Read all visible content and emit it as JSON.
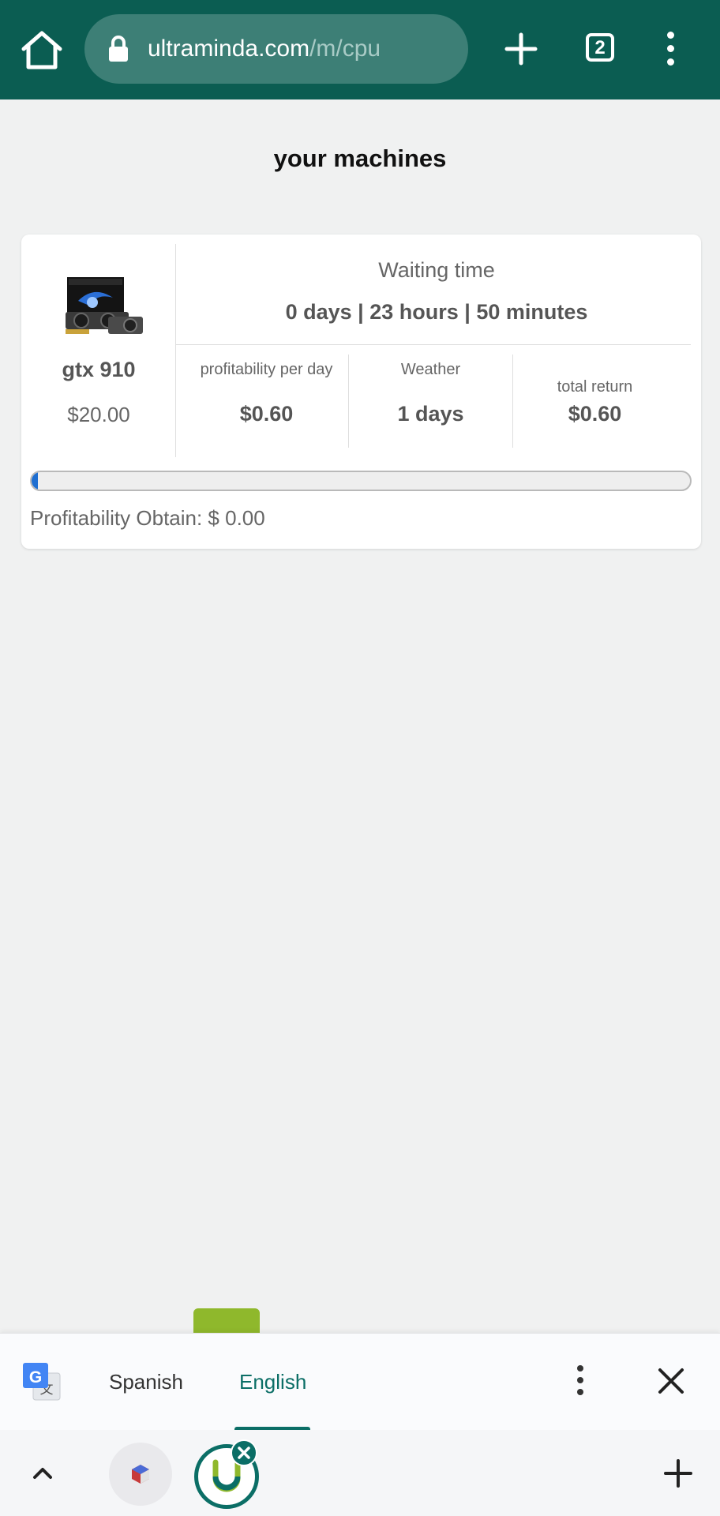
{
  "browser": {
    "url_domain": "ultraminda.com",
    "url_path": "/m/cpu",
    "tab_count": "2",
    "icons": [
      "home-icon",
      "lock-icon",
      "plus-icon",
      "tab-switcher-icon",
      "overflow-menu-icon"
    ],
    "colors": {
      "toolbar": "#0b5d52",
      "omnibox": "#3d7f76"
    }
  },
  "page": {
    "title": "your machines"
  },
  "machine": {
    "name": "gtx 910",
    "price": "$20.00",
    "waiting_label": "Waiting time",
    "waiting_value": "0 days | 23 hours | 50 minutes",
    "stats": [
      {
        "label": "profitability per day",
        "value": "$0.60"
      },
      {
        "label": "Weather",
        "value": "1 days"
      },
      {
        "label": "total return",
        "value": "$0.60"
      }
    ],
    "progress_fraction": 0.01,
    "profit_obtain": "Profitability Obtain: $ 0.00",
    "colors": {
      "progress": "#1f6fd1"
    }
  },
  "translate_bar": {
    "source_language": "Spanish",
    "target_language": "English",
    "icons": [
      "google-translate-icon",
      "overflow-menu-icon",
      "close-icon"
    ],
    "colors": {
      "active": "#0b6e66"
    }
  },
  "bottom_bar": {
    "icons": [
      "chevron-up-icon",
      "site-favicon-icon",
      "ultraminda-app-icon",
      "close-badge-icon",
      "plus-icon"
    ]
  }
}
